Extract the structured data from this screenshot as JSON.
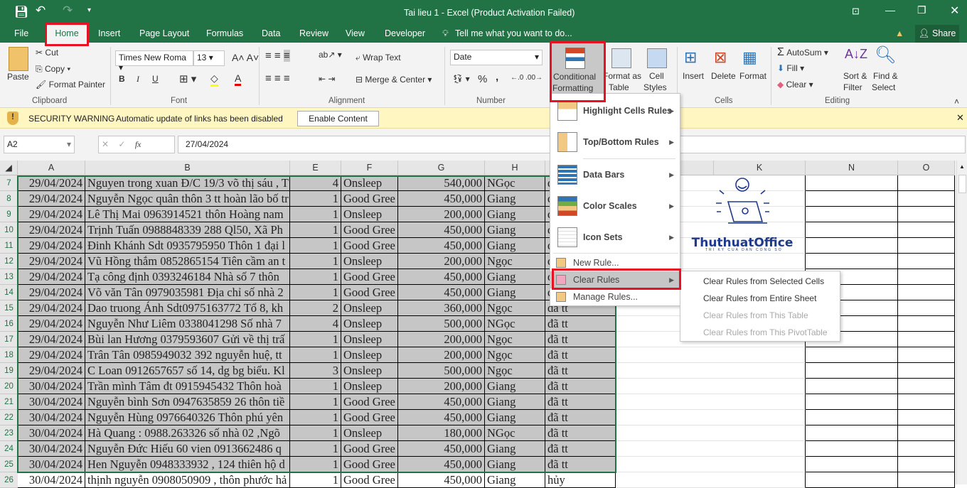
{
  "window": {
    "title": "Tai lieu 1 - Excel (Product Activation Failed)",
    "share": "Share",
    "tell_me": "Tell me what you want to do..."
  },
  "tabs": [
    "File",
    "Home",
    "Insert",
    "Page Layout",
    "Formulas",
    "Data",
    "Review",
    "View",
    "Developer"
  ],
  "ribbon": {
    "clipboard": {
      "paste": "Paste",
      "cut": "Cut",
      "copy": "Copy",
      "format_painter": "Format Painter",
      "group": "Clipboard"
    },
    "font": {
      "name": "Times New Roma",
      "size": "13",
      "bold": "B",
      "italic": "I",
      "underline": "U",
      "group": "Font"
    },
    "alignment": {
      "wrap": "Wrap Text",
      "merge": "Merge & Center",
      "group": "Alignment"
    },
    "number": {
      "format": "Date",
      "percent": "%",
      "comma": ",",
      "group": "Number"
    },
    "styles": {
      "cond1": "Conditional",
      "cond2": "Formatting",
      "fmt1": "Format as",
      "fmt2": "Table",
      "cell1": "Cell",
      "cell2": "Styles"
    },
    "cells": {
      "insert": "Insert",
      "delete": "Delete",
      "format": "Format",
      "group": "Cells"
    },
    "editing": {
      "autosum": "AutoSum",
      "fill": "Fill",
      "clear": "Clear",
      "sort1": "Sort &",
      "sort2": "Filter",
      "find1": "Find &",
      "find2": "Select",
      "group": "Editing"
    }
  },
  "security": {
    "title": "SECURITY WARNING",
    "message": "Automatic update of links has been disabled",
    "button": "Enable Content"
  },
  "formula_bar": {
    "name_box": "A2",
    "fx": "fx",
    "value": "27/04/2024"
  },
  "columns": [
    "A",
    "B",
    "E",
    "F",
    "G",
    "H",
    "",
    "",
    "K",
    "N",
    "O"
  ],
  "rows": [
    {
      "n": "7",
      "a": "29/04/2024",
      "b": "Nguyen trong xuan Đ/C 19/3 võ thị sáu , T",
      "e": "4",
      "f": "Onsleep",
      "g": "540,000",
      "h": "NGọc",
      "i": "đ"
    },
    {
      "n": "8",
      "a": "29/04/2024",
      "b": "Nguyễn Ngọc quân thôn 3 tt hoàn lão bố tr",
      "e": "1",
      "f": "Good Gree",
      "g": "450,000",
      "h": "Giang",
      "i": "đ"
    },
    {
      "n": "9",
      "a": "29/04/2024",
      "b": "Lê Thị Mai 0963914521 thôn Hoàng nam",
      "e": "1",
      "f": "Onsleep",
      "g": "200,000",
      "h": "Giang",
      "i": "đ"
    },
    {
      "n": "10",
      "a": "29/04/2024",
      "b": "Trịnh Tuấn 0988848339 288 Ql50, Xã Ph",
      "e": "1",
      "f": "Good Gree",
      "g": "450,000",
      "h": "Giang",
      "i": "đ"
    },
    {
      "n": "11",
      "a": "29/04/2024",
      "b": "Đinh Khánh Sdt 0935795950 Thôn 1 đại l",
      "e": "1",
      "f": "Good Gree",
      "g": "450,000",
      "h": "Giang",
      "i": "đ"
    },
    {
      "n": "12",
      "a": "29/04/2024",
      "b": "Vũ Hồng thắm 0852865154 Tiên cầm an t",
      "e": "1",
      "f": "Onsleep",
      "g": "200,000",
      "h": "Ngọc",
      "i": "đ"
    },
    {
      "n": "13",
      "a": "29/04/2024",
      "b": "Tạ công định 0393246184 Nhà số 7 thôn",
      "e": "1",
      "f": "Good Gree",
      "g": "450,000",
      "h": "Giang",
      "i": "đ"
    },
    {
      "n": "14",
      "a": "29/04/2024",
      "b": " Võ văn Tân 0979035981 Địa chỉ số nhà 2",
      "e": "1",
      "f": "Good Gree",
      "g": "450,000",
      "h": "Giang",
      "i": "đ"
    },
    {
      "n": "15",
      "a": "29/04/2024",
      "b": "Dao truong Ánh  Sdt0975163772 Tổ 8, kh",
      "e": "2",
      "f": "Onsleep",
      "g": "360,000",
      "h": "Ngọc",
      "i": "đã tt"
    },
    {
      "n": "16",
      "a": "29/04/2024",
      "b": "Nguyễn Như Liêm 0338041298 Số nhà 7",
      "e": "4",
      "f": "Onsleep",
      "g": "500,000",
      "h": "NGọc",
      "i": "đã tt"
    },
    {
      "n": "17",
      "a": "29/04/2024",
      "b": "Bùi lan Hương 0379593607 Gửi về thị trấ",
      "e": "1",
      "f": "Onsleep",
      "g": "200,000",
      "h": "Ngọc",
      "i": "đã tt"
    },
    {
      "n": "18",
      "a": "29/04/2024",
      "b": "Trân Tân 0985949032 392  nguyễn huệ, tt",
      "e": "1",
      "f": "Onsleep",
      "g": "200,000",
      "h": "Ngọc",
      "i": "đã tt"
    },
    {
      "n": "19",
      "a": "29/04/2024",
      "b": "C Loan 0912657657 số 14, dg bg biểu. Kl",
      "e": "3",
      "f": "Onsleep",
      "g": "500,000",
      "h": "Ngọc",
      "i": "đã tt"
    },
    {
      "n": "20",
      "a": "30/04/2024",
      "b": " Trần mình Tâm đt 0915945432 Thôn hoà",
      "e": "1",
      "f": "Onsleep",
      "g": "200,000",
      "h": "Giang",
      "i": "đã tt"
    },
    {
      "n": "21",
      "a": "30/04/2024",
      "b": "Nguyễn bình Sơn 0947635859 26 thôn tiề",
      "e": "1",
      "f": "Good Gree",
      "g": "450,000",
      "h": "Giang",
      "i": "đã tt"
    },
    {
      "n": "22",
      "a": "30/04/2024",
      "b": "Nguyễn Hùng 0976640326 Thôn phú yên",
      "e": "1",
      "f": "Good Gree",
      "g": "450,000",
      "h": "Giang",
      "i": "đã tt"
    },
    {
      "n": "23",
      "a": "30/04/2024",
      "b": "Hà Quang : 0988.263326 số nhà 02 ,Ngõ",
      "e": "1",
      "f": "Onsleep",
      "g": "180,000",
      "h": "NGọc",
      "i": "đã tt"
    },
    {
      "n": "24",
      "a": "30/04/2024",
      "b": "Nguyễn Đức Hiếu 60 vien 0913662486 q",
      "e": "1",
      "f": "Good Gree",
      "g": "450,000",
      "h": "Giang",
      "i": "đã tt"
    },
    {
      "n": "25",
      "a": "30/04/2024",
      "b": "Hen Nguyễn 0948333932 , 124 thiên hộ d",
      "e": "1",
      "f": "Good Gree",
      "g": "450,000",
      "h": "Giang",
      "i": "đã tt"
    },
    {
      "n": "26",
      "a": "30/04/2024",
      "b": "thịnh nguyễn 0908050909 , thôn phước hả",
      "e": "1",
      "f": "Good Gree",
      "g": "450,000",
      "h": "Giang",
      "i": "hủy"
    }
  ],
  "logo": {
    "name": "ThuthuatOffice",
    "tagline": "TRI KY CUA DAN CONG SO"
  },
  "menu": {
    "items": [
      "Highlight Cells Rules",
      "Top/Bottom Rules",
      "Data Bars",
      "Color Scales",
      "Icon Sets"
    ],
    "new_rule": "New Rule...",
    "clear_rules": "Clear Rules",
    "manage_rules": "Manage Rules..."
  },
  "submenu": {
    "items": [
      "Clear Rules from Selected Cells",
      "Clear Rules from Entire Sheet",
      "Clear Rules from This Table",
      "Clear Rules from This PivotTable"
    ],
    "disabled": [
      false,
      false,
      true,
      true
    ]
  },
  "colors": {
    "excel_green": "#217346",
    "selection": "#c6c6c6",
    "highlight_box": "#e81123",
    "warning_bg": "#fff6c2"
  }
}
